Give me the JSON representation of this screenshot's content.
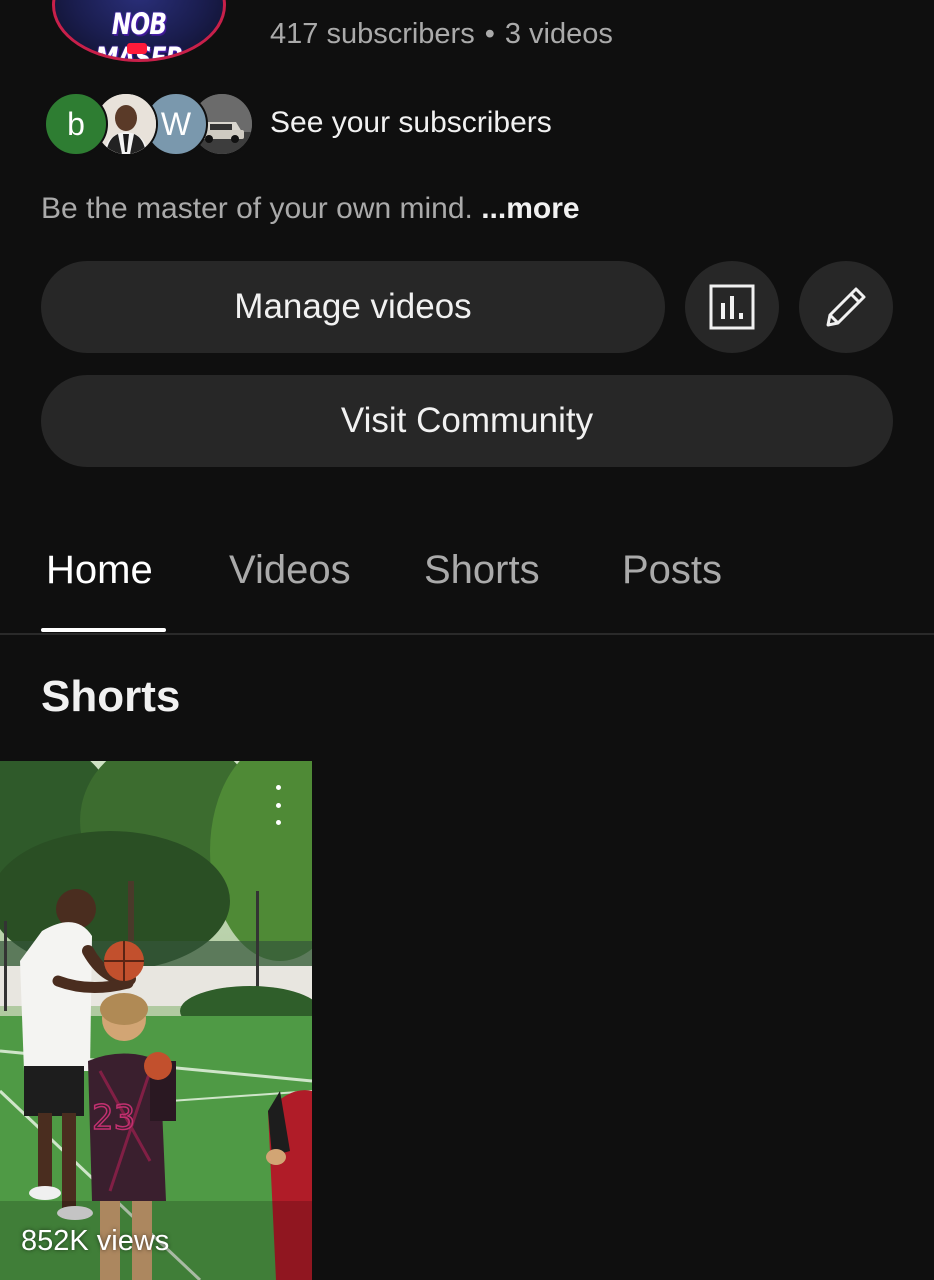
{
  "channel": {
    "logo_text": "NOB MASER",
    "subscribers": "417 subscribers",
    "separator": "•",
    "videos": "3 videos",
    "see_subscribers": "See your subscribers",
    "subscriber_avatars": [
      "b",
      "photo",
      "W",
      "car"
    ],
    "description": "Be the master of your own mind.",
    "more_label": "...more"
  },
  "actions": {
    "manage_videos": "Manage videos",
    "analytics_icon": "analytics-icon",
    "edit_icon": "pencil-icon",
    "visit_community": "Visit Community"
  },
  "tabs": [
    {
      "label": "Home",
      "active": true
    },
    {
      "label": "Videos",
      "active": false
    },
    {
      "label": "Shorts",
      "active": false
    },
    {
      "label": "Posts",
      "active": false
    }
  ],
  "section": {
    "title": "Shorts"
  },
  "shorts": [
    {
      "views": "852K views",
      "jersey": "23"
    }
  ],
  "colors": {
    "background": "#0f0f0f",
    "button": "#272727",
    "secondary_text": "#aaaaaa",
    "avatar_b": "#2e7d32",
    "avatar_w": "#7a98ad"
  }
}
